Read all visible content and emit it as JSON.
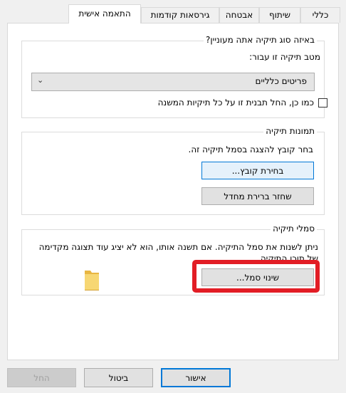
{
  "tabs": [
    {
      "label": "כללי"
    },
    {
      "label": "שיתוף"
    },
    {
      "label": "אבטחה"
    },
    {
      "label": "גירסאות קודמות"
    },
    {
      "label": "התאמה אישית"
    }
  ],
  "folder_type_group": {
    "title": "באיזה סוג תיקיה אתה מעוניין?",
    "optimize_label": "מטב תיקיה זו עבור:",
    "selected_option": "פריטים כלליים",
    "apply_subfolders_label": "כמו כן, החל תבנית זו על כל תיקיות המשנה"
  },
  "folder_pictures_group": {
    "title": "תמונות תיקיה",
    "instruction": "בחר קובץ להצגה בסמל תיקיה זה.",
    "choose_file_button": "בחירת קובץ...",
    "restore_default_button": "שחזר ברירת מחדל"
  },
  "folder_icons_group": {
    "title": "סמלי תיקיה",
    "description": "ניתן לשנות את סמל התיקיה. אם תשנה אותו, הוא לא יציג עוד תצוגה מקדימה של תוכן התיקיה.",
    "change_icon_button": "שינוי סמל..."
  },
  "footer": {
    "ok_button": "אישור",
    "cancel_button": "ביטול",
    "apply_button": "החל"
  },
  "colors": {
    "highlight": "#e21d25",
    "accent": "#0078d7"
  }
}
